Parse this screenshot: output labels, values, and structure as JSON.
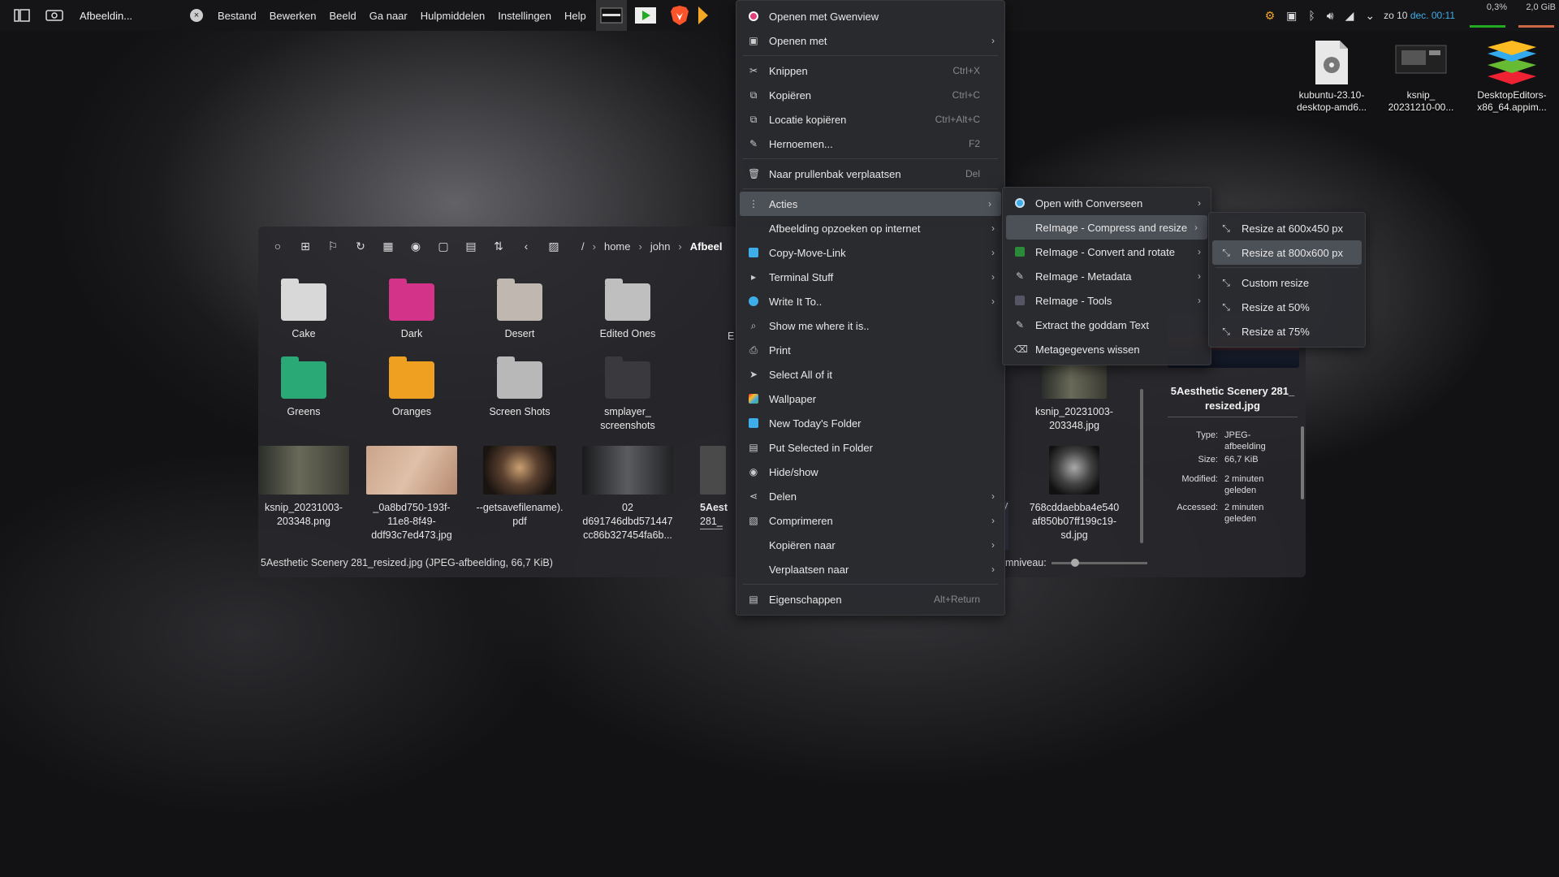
{
  "panel": {
    "app_title": "Afbeeldin...",
    "menu": [
      "Bestand",
      "Bewerken",
      "Beeld",
      "Ga naar",
      "Hulpmiddelen",
      "Instellingen",
      "Help"
    ],
    "clock_date": "zo 10",
    "clock_month": "dec.",
    "clock_time": "00:11",
    "cpu": "0,3%",
    "mem": "2,0 GiB"
  },
  "desktop": {
    "icons": [
      {
        "label1": "kubuntu-23.10-",
        "label2": "desktop-amd6..."
      },
      {
        "label1": "ksnip_",
        "label2": "20231210-00..."
      },
      {
        "label1": "DesktopEditors-",
        "label2": "x86_64.appim..."
      }
    ]
  },
  "filemanager": {
    "breadcrumb": [
      "/",
      "home",
      "john",
      "Afbeel"
    ],
    "folders": [
      {
        "name": "Cake"
      },
      {
        "name": "Dark"
      },
      {
        "name": "Desert"
      },
      {
        "name": "Edited Ones"
      },
      {
        "name": "Greens"
      },
      {
        "name": "Oranges"
      },
      {
        "name": "Screen Shots"
      },
      {
        "name": "smplayer_",
        "name2": "screenshots"
      }
    ],
    "partial_e": "E",
    "files": [
      {
        "l1": "ksnip_20231003-",
        "l2": "203348.png",
        "l3": ""
      },
      {
        "l1": "_0a8bd750-193f-",
        "l2": "11e8-8f49-",
        "l3": "ddf93c7ed473.jpg"
      },
      {
        "l1": "--getsavefilename).",
        "l2": "pdf",
        "l3": ""
      },
      {
        "l1": "02",
        "l2": "d691746dbd571447",
        "l3": "cc86b327454fa6b..."
      },
      {
        "l1": "5Aest",
        "l2": "281_",
        "l3": ""
      }
    ],
    "right_files": [
      {
        "l1": "ksnip_20231003-",
        "l2": "203348.jpg",
        "l3": ""
      },
      {
        "l1": "768cddaebba4e540",
        "l2": "af850b07ff199c19-",
        "l3": "sd.jpg"
      }
    ],
    "partial_y": "ry",
    "status": "5Aesthetic Scenery 281_resized.jpg (JPEG-afbeelding, 66,7 KiB)",
    "zoom_label": "mniveau:",
    "zoom_fraction": 0.2
  },
  "info": {
    "filename1": "5Aesthetic Scenery 281_",
    "filename2": "resized.jpg",
    "rows": [
      {
        "k": "Type:",
        "v1": "JPEG-",
        "v2": "afbeelding"
      },
      {
        "k": "Size:",
        "v1": "66,7 KiB",
        "v2": ""
      },
      {
        "k": "Modified:",
        "v1": "2 minuten",
        "v2": "geleden"
      },
      {
        "k": "Accessed:",
        "v1": "2 minuten",
        "v2": "geleden"
      }
    ]
  },
  "main_menu": [
    {
      "label": "Openen met Gwenview",
      "shortcut": "",
      "submenu": false,
      "icon": "gwenview-icon"
    },
    {
      "label": "Openen met",
      "shortcut": "",
      "submenu": true,
      "icon": "open-with-icon"
    },
    {
      "sep": true
    },
    {
      "label": "Knippen",
      "shortcut": "Ctrl+X",
      "submenu": false,
      "icon": "cut-icon"
    },
    {
      "label": "Kopiëren",
      "shortcut": "Ctrl+C",
      "submenu": false,
      "icon": "copy-icon"
    },
    {
      "label": "Locatie kopiëren",
      "shortcut": "Ctrl+Alt+C",
      "submenu": false,
      "icon": "copy-location-icon"
    },
    {
      "label": "Hernoemen...",
      "shortcut": "F2",
      "submenu": false,
      "icon": "rename-icon"
    },
    {
      "sep": true
    },
    {
      "label": "Naar prullenbak verplaatsen",
      "shortcut": "Del",
      "submenu": false,
      "icon": "trash-icon"
    },
    {
      "sep": true
    },
    {
      "label": "Acties",
      "shortcut": "",
      "submenu": true,
      "icon": "actions-icon",
      "highlight": true
    },
    {
      "label": "Afbeelding opzoeken op internet",
      "shortcut": "",
      "submenu": true,
      "icon": ""
    },
    {
      "label": "Copy-Move-Link",
      "shortcut": "",
      "submenu": true,
      "icon": "copy-move-icon"
    },
    {
      "label": "Terminal Stuff",
      "shortcut": "",
      "submenu": true,
      "icon": "terminal-icon"
    },
    {
      "label": "Write It To..",
      "shortcut": "",
      "submenu": true,
      "icon": "write-icon"
    },
    {
      "label": "Show me where it is..",
      "shortcut": "",
      "submenu": false,
      "icon": "search-icon"
    },
    {
      "label": "Print",
      "shortcut": "",
      "submenu": false,
      "icon": "print-icon"
    },
    {
      "label": "Select All of it",
      "shortcut": "",
      "submenu": false,
      "icon": "select-icon"
    },
    {
      "label": "Wallpaper",
      "shortcut": "",
      "submenu": false,
      "icon": "wallpaper-icon"
    },
    {
      "label": "New Today's Folder",
      "shortcut": "",
      "submenu": false,
      "icon": "new-folder-icon"
    },
    {
      "label": "Put Selected in Folder",
      "shortcut": "",
      "submenu": false,
      "icon": "folder-put-icon"
    },
    {
      "label": "Hide/show",
      "shortcut": "",
      "submenu": false,
      "icon": "eye-icon"
    },
    {
      "label": "Delen",
      "shortcut": "",
      "submenu": true,
      "icon": "share-icon"
    },
    {
      "label": "Comprimeren",
      "shortcut": "",
      "submenu": true,
      "icon": "compress-icon"
    },
    {
      "label": "Kopiëren naar",
      "shortcut": "",
      "submenu": true,
      "icon": ""
    },
    {
      "label": "Verplaatsen naar",
      "shortcut": "",
      "submenu": true,
      "icon": ""
    },
    {
      "sep": true
    },
    {
      "label": "Eigenschappen",
      "shortcut": "Alt+Return",
      "submenu": false,
      "icon": "properties-icon"
    }
  ],
  "acties_menu": [
    {
      "label": "Open with Converseen",
      "submenu": true,
      "icon": "converseen-icon"
    },
    {
      "label": "ReImage - Compress and resize",
      "submenu": true,
      "icon": "",
      "highlight": true
    },
    {
      "label": "ReImage - Convert and rotate",
      "submenu": true,
      "icon": "image-convert-icon"
    },
    {
      "label": "ReImage - Metadata",
      "submenu": true,
      "icon": "metadata-icon"
    },
    {
      "label": "ReImage - Tools",
      "submenu": true,
      "icon": "tools-icon"
    },
    {
      "label": "Extract the goddam Text",
      "submenu": false,
      "icon": "extract-text-icon"
    },
    {
      "label": "Metagegevens wissen",
      "submenu": false,
      "icon": "erase-metadata-icon"
    }
  ],
  "resize_menu": [
    {
      "label": "Resize at 600x450 px"
    },
    {
      "label": "Resize at 800x600 px",
      "highlight": true
    },
    {
      "sep": true
    },
    {
      "label": "Custom resize"
    },
    {
      "label": "Resize at 50%"
    },
    {
      "label": "Resize at 75%"
    }
  ],
  "colors": {
    "accent": "#3daee9",
    "menu_bg": "#2a2b2f",
    "highlight": "#50545c"
  }
}
